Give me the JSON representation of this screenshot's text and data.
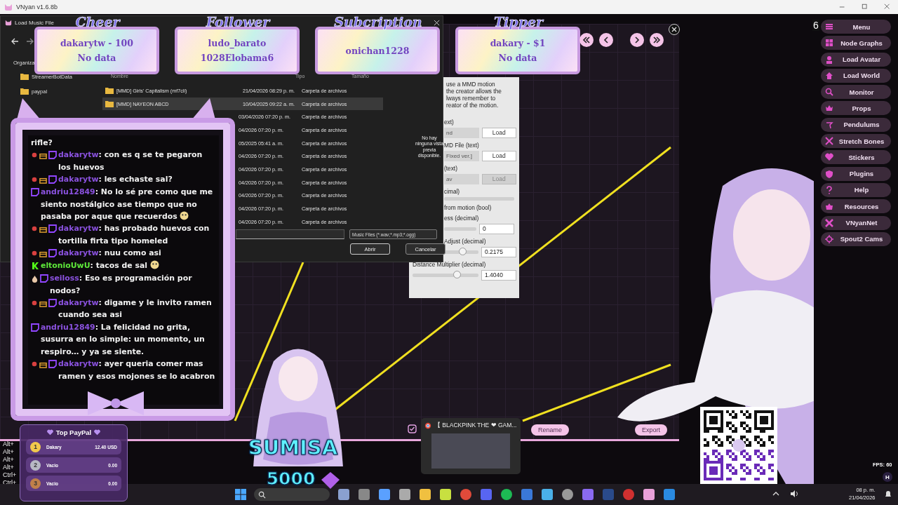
{
  "window": {
    "title": "VNyan v1.6.8b"
  },
  "file_dialog": {
    "title": "Load Music File",
    "toolbar_label": "Organiza",
    "sidebar_items": [
      {
        "label": "StreamerBotData"
      },
      {
        "label": "paypal"
      }
    ],
    "columns": [
      "Nombre",
      "Tipo",
      "Tamaño"
    ],
    "rows": [
      {
        "name": "[MMD] Girls' Capitalism (mf7cli)",
        "date": "21/04/2026 08:29 p. m.",
        "type": "Carpeta de archivos",
        "selected": false
      },
      {
        "name": "[MMD] NAYEON ABCD",
        "date": "10/04/2025 09:22 a. m.",
        "type": "Carpeta de archivos",
        "selected": true
      },
      {
        "date": "03/04/2026 07:20 p. m.",
        "type": "Carpeta de archivos",
        "selected": false
      },
      {
        "date": "04/2026 07:20 p. m.",
        "type": "Carpeta de archivos",
        "selected": false
      },
      {
        "date": "05/2025 05:41 a. m.",
        "type": "Carpeta de archivos",
        "selected": false
      },
      {
        "date": "04/2026 07:20 p. m.",
        "type": "Carpeta de archivos",
        "selected": false
      },
      {
        "date": "04/2026 07:20 p. m.",
        "type": "Carpeta de archivos",
        "selected": false
      },
      {
        "date": "04/2026 07:20 p. m.",
        "type": "Carpeta de archivos",
        "selected": false
      },
      {
        "date": "04/2026 07:20 p. m.",
        "type": "Carpeta de archivos",
        "selected": false
      },
      {
        "date": "04/2026 07:20 p. m.",
        "type": "Carpeta de archivos",
        "selected": false
      },
      {
        "date": "04/2026 07:20 p. m.",
        "type": "Carpeta de archivos",
        "selected": false
      }
    ],
    "filter": "Music Files (*.wav;*.mp3;*.ogg)",
    "buttons": [
      "Abrir",
      "Cancelar"
    ],
    "preview_text": "No hay ninguna vista previa disponible."
  },
  "alerts": [
    {
      "title": "Cheer",
      "lines": [
        "dakarytw - 100",
        "No data"
      ]
    },
    {
      "title": "Follower",
      "lines": [
        "ludo_barato",
        "1028Elobama6"
      ]
    },
    {
      "title": "Subcription",
      "lines": [
        "onichan1228"
      ]
    },
    {
      "title": "Tipper",
      "lines": [
        "dakary - $1",
        "No data"
      ]
    }
  ],
  "mmd_panel": {
    "description": "use a MMD motion\nthe creator allows the\nlways remember to\nreator of the motion.",
    "rows": [
      {
        "kind": "field",
        "label": "ext)",
        "value": "nd",
        "button": "Load",
        "disabled": false
      },
      {
        "kind": "field",
        "label": "MD File (text)",
        "value": "Fixed ver.]",
        "button": "Load",
        "disabled": false
      },
      {
        "kind": "field",
        "label": "(text)",
        "value": "av",
        "button": "Load",
        "disabled": true
      },
      {
        "kind": "bar",
        "label": "cimal)"
      },
      {
        "kind": "label",
        "label": "from motion (bool)"
      },
      {
        "kind": "value",
        "label": "ess (decimal)",
        "value": "0"
      },
      {
        "kind": "slider",
        "label": "Adjust (decimal)",
        "value": "0.2175",
        "level": 0.56
      },
      {
        "kind": "slider",
        "label": "Distance Multiplier (decimal)",
        "value": "1.4040",
        "level": 0.68
      }
    ]
  },
  "chat": {
    "messages": [
      {
        "kind": "none",
        "text": "rifle?"
      },
      {
        "kind": "sub",
        "user": "dakarytw",
        "color": "#8b52e0",
        "text": ": con es q se te pegaron los huevos"
      },
      {
        "kind": "sub",
        "user": "dakarytw",
        "color": "#8b52e0",
        "text": ": les echaste sal?"
      },
      {
        "kind": "twitch",
        "user": "andriu12849",
        "color": "#8b52e0",
        "text": ": No lo sé pre como que me siento nostálgico ase tiempo que no pasaba por aque que recuerdos",
        "emoji": true
      },
      {
        "kind": "sub",
        "user": "dakarytw",
        "color": "#8b52e0",
        "text": ": has probado huevos con tortilla firta tipo homeled"
      },
      {
        "kind": "sub",
        "user": "dakarytw",
        "color": "#8b52e0",
        "text": ": nuu como asi"
      },
      {
        "kind": "kick",
        "user": "eltonioUwU",
        "color": "#5ee83a",
        "text": ": tacos de sal",
        "emoji": true
      },
      {
        "kind": "gem",
        "user": "seiloss",
        "color": "#8b52e0",
        "text": ": Eso es programación por nodos?"
      },
      {
        "kind": "sub",
        "user": "dakarytw",
        "color": "#8b52e0",
        "text": ": digame y le invito ramen cuando sea asi"
      },
      {
        "kind": "twitch",
        "user": "andriu12849",
        "color": "#8b52e0",
        "text": ": La felicidad no grita, susurra en lo simple: un momento, un respiro… y ya se siente."
      },
      {
        "kind": "sub",
        "user": "dakarytw",
        "color": "#8b52e0",
        "text": ": ayer queria comer mas ramen y esos mojones se lo acabron"
      }
    ]
  },
  "menu": {
    "badge": "6",
    "items": [
      "Menu",
      "Node Graphs",
      "Load Avatar",
      "Load World",
      "Monitor",
      "Props",
      "Pendulums",
      "Stretch Bones",
      "Stickers",
      "Plugins",
      "Help",
      "Resources",
      "VNyanNet",
      "Spout2 Cams"
    ]
  },
  "shortcuts": [
    "Alt+",
    "Alt+",
    "Alt+",
    "Alt+",
    "Ctrl+",
    "Ctrl+"
  ],
  "tip_panel": {
    "title": "Top PayPal",
    "rows": [
      {
        "rank": "1",
        "name": "Dakary",
        "amount": "12.40 USD",
        "color": "#f2c94c"
      },
      {
        "rank": "2",
        "name": "Vacio",
        "amount": "0.00",
        "color": "#b8b8c4"
      },
      {
        "rank": "3",
        "name": "Vacio",
        "amount": "0.00",
        "color": "#c0804a"
      }
    ]
  },
  "goal": {
    "name": "SUMISA",
    "amount": "5000"
  },
  "graph_buttons": [
    "Rename",
    "Export"
  ],
  "browser_preview": {
    "title": "【 BLACKPINK THE ❤ GAM..."
  },
  "overlay": {
    "fps": "FPS: 60",
    "hotkey": "H"
  },
  "taskbar": {
    "time": "08 p. m.",
    "date": "21/04/2026"
  }
}
